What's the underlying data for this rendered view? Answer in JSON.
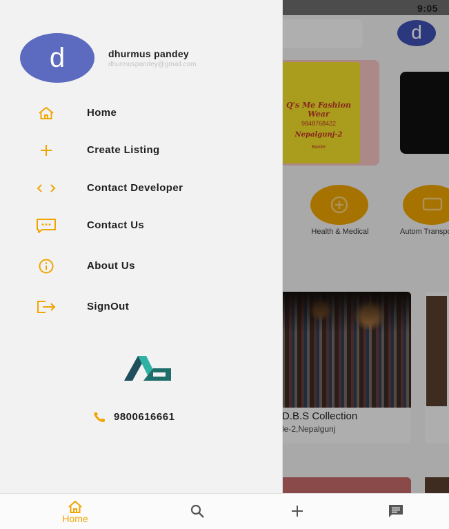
{
  "status_bar": {
    "time": "9:05"
  },
  "background": {
    "avatar_letter": "d",
    "banner": {
      "line1": "Q's Me Fashion Wear",
      "line2": "9848768422",
      "line3": "Nepalgunj-2",
      "line4": "Banke"
    },
    "categories": [
      {
        "label": "Health & Medical"
      },
      {
        "label": "Autom Transpo"
      }
    ],
    "featured_card": {
      "title": "D.B.S Collection",
      "subtitle": "le-2,Nepalgunj"
    }
  },
  "drawer": {
    "avatar_letter": "d",
    "user_name": "dhurmus pandey",
    "user_email": "dhurmuspandey@gmail.com",
    "menu": [
      {
        "label": "Home",
        "icon": "home-icon"
      },
      {
        "label": "Create Listing",
        "icon": "plus-icon"
      },
      {
        "label": "Contact Developer",
        "icon": "code-icon"
      },
      {
        "label": "Contact Us",
        "icon": "message-icon"
      },
      {
        "label": "About Us",
        "icon": "info-icon"
      },
      {
        "label": "SignOut",
        "icon": "sign-out-icon"
      }
    ],
    "phone": "9800616661"
  },
  "bottom_nav": {
    "home_label": "Home"
  },
  "colors": {
    "accent": "#f0a500",
    "avatar": "#5c6bc0",
    "logo_dark": "#1f4e5c",
    "logo_light": "#2fb1a3"
  }
}
